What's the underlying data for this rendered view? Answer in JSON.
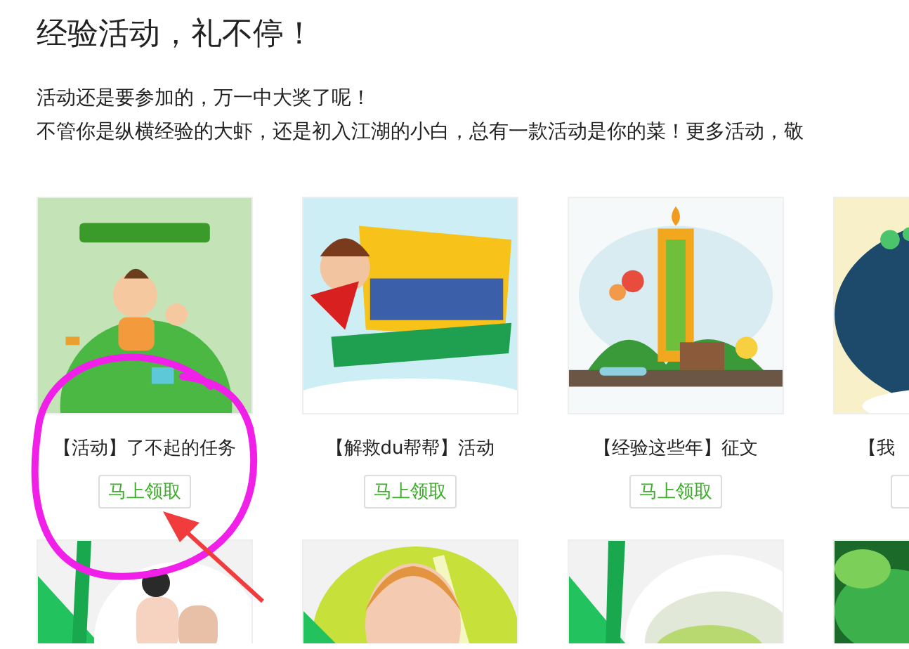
{
  "heading": "经验活动，礼不停！",
  "intro": [
    "活动还是要参加的，万一中大奖了呢！",
    "不管你是纵横经验的大虾，还是初入江湖的小白，总有一款活动是你的菜！更多活动，敬"
  ],
  "cards": [
    {
      "kind": "picture",
      "title": "【活动】了不起的任务",
      "button": "马上领取"
    },
    {
      "kind": "picture",
      "title": "【解救du帮帮】活动",
      "button": "马上领取"
    },
    {
      "kind": "picture",
      "title": "【经验这些年】征文",
      "button": "马上领取"
    },
    {
      "kind": "picture",
      "title": "【我"
    }
  ],
  "annotations": [
    {
      "kind": "ellipse"
    },
    {
      "kind": "arrow"
    }
  ]
}
